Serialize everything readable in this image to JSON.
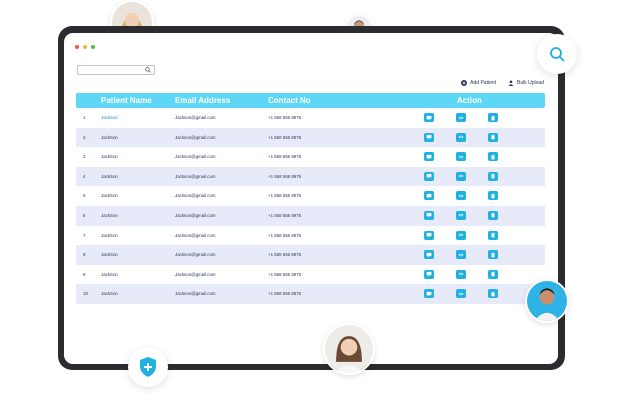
{
  "window": {
    "dot_colors": [
      "#f15a45",
      "#f9b626",
      "#3dc455"
    ]
  },
  "search": {
    "value": "",
    "placeholder": ""
  },
  "toolbar": {
    "add_patient_label": "Add Patient",
    "bulk_upload_label": "Bulk Upload"
  },
  "table": {
    "headers": {
      "name": "Patient Name",
      "email": "Email Address",
      "contact": "Contact No",
      "action": "Action"
    },
    "rows": [
      {
        "no": "1",
        "name": "JackSon",
        "email": "Jackson@gmail.com",
        "contact": "+1 568 556 8975"
      },
      {
        "no": "2",
        "name": "JackSon",
        "email": "Jackson@gmail.com",
        "contact": "+1 568 556 8975"
      },
      {
        "no": "3",
        "name": "JackSon",
        "email": "Jackson@gmail.com",
        "contact": "+1 568 556 8975"
      },
      {
        "no": "4",
        "name": "JackSon",
        "email": "Jackson@gmail.com",
        "contact": "+1 568 568 8975"
      },
      {
        "no": "5",
        "name": "JackSon",
        "email": "Jackson@gmail.com",
        "contact": "+1 568 556 8975"
      },
      {
        "no": "6",
        "name": "JackSon",
        "email": "Jackson@gmail.com",
        "contact": "+1 568 556 8975"
      },
      {
        "no": "7",
        "name": "JackSon",
        "email": "Jackson@gmail.com",
        "contact": "+1 568 556 8975"
      },
      {
        "no": "8",
        "name": "JackSon",
        "email": "Jackson@gmail.com",
        "contact": "+1 568 556 8975"
      },
      {
        "no": "9",
        "name": "JackSon",
        "email": "Jackson@gmail.com",
        "contact": "+1 568 556 8975"
      },
      {
        "no": "10",
        "name": "JackSon",
        "email": "Jackson@gmail.com",
        "contact": "+1 568 556 8975"
      }
    ]
  },
  "colors": {
    "header": "#5ed6f6",
    "action_button": "#1fb2e0",
    "row_alt": "#e7eaf9"
  },
  "icons": {
    "row_actions": [
      "message-icon",
      "eye-icon",
      "trash-icon"
    ]
  }
}
